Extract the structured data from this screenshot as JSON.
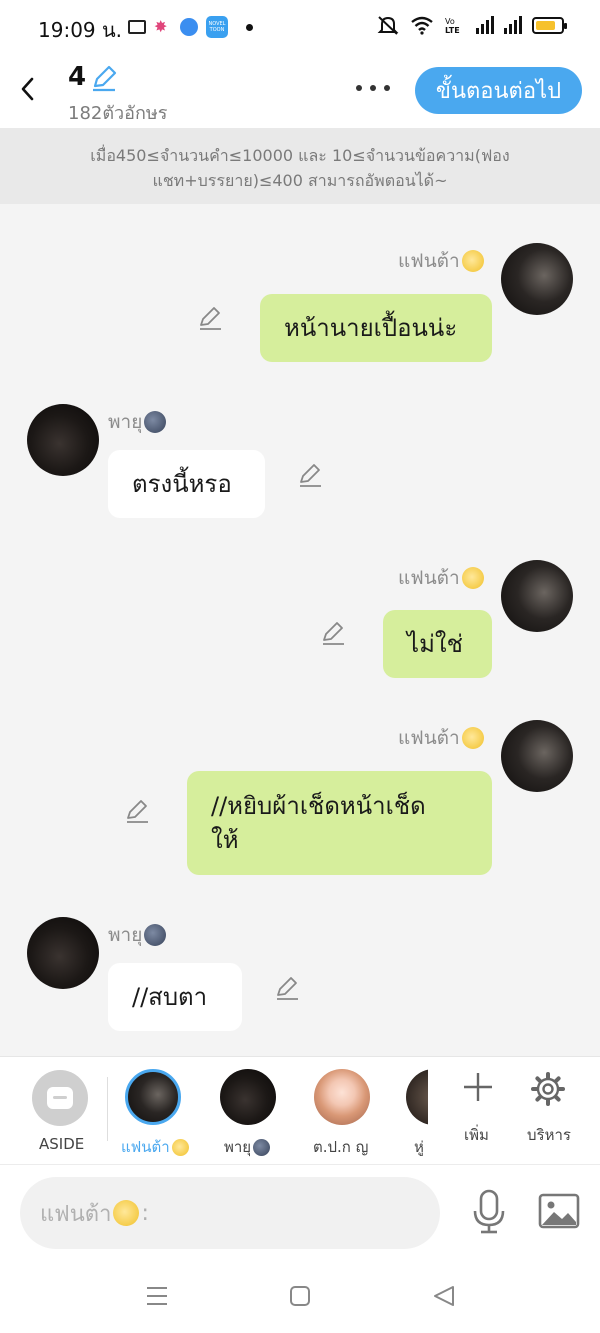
{
  "status_bar": {
    "time": "19:09 น.",
    "app_toon_label": "NOVEL TOON"
  },
  "header": {
    "episode_number": "4",
    "char_count": "182ตัวอักษร",
    "next_button": "ขั้นตอนต่อไป"
  },
  "notice": {
    "line1": "เมื่อ450≤จำนวนคำ≤10000 และ 10≤จำนวนข้อความ(ฟอง",
    "line2": "แชท+บรรยาย)≤400 สามารถอัพตอนได้~"
  },
  "messages": [
    {
      "sender": "แฟนต้า",
      "side": "right",
      "text": "หน้านายเปื้อนน่ะ"
    },
    {
      "sender": "พายุ",
      "side": "left",
      "text": "ตรงนี้หรอ"
    },
    {
      "sender": "แฟนต้า",
      "side": "right",
      "text": "ไม่ใช่"
    },
    {
      "sender": "แฟนต้า",
      "side": "right",
      "text_line1": "//หยิบผ้าเช็ดหน้าเช็ด",
      "text_line2": "ให้"
    },
    {
      "sender": "พายุ",
      "side": "left",
      "text": "//สบตา"
    }
  ],
  "characters": {
    "aside": "ASIDE",
    "items": [
      {
        "name": "แฟนต้า",
        "selected": true
      },
      {
        "name": "พายุ",
        "selected": false
      },
      {
        "name": "ต.ป.ก ญ",
        "selected": false
      },
      {
        "name": "หู่",
        "selected": false
      }
    ],
    "add_label": "เพิ่ม",
    "manage_label": "บริหาร"
  },
  "composer": {
    "placeholder_prefix": "แฟนต้า",
    "placeholder_suffix": ":"
  },
  "colors": {
    "accent": "#4aa8ef",
    "bubble_green": "#d6ee9c",
    "bubble_white": "#ffffff"
  }
}
